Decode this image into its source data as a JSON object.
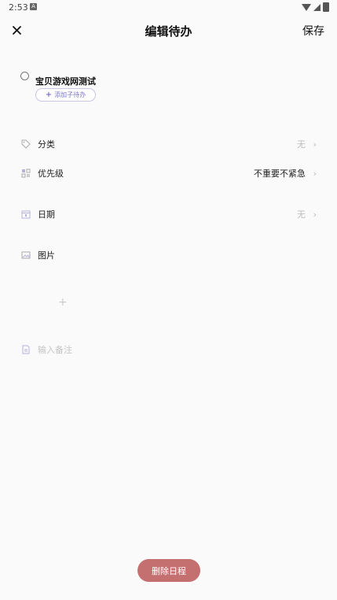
{
  "status_bar": {
    "time": "2:53",
    "left_icon": "A"
  },
  "header": {
    "title": "编辑待办",
    "save_label": "保存"
  },
  "task": {
    "title": "宝贝游戏网测试",
    "add_subtask_label": "添加子待办"
  },
  "fields": {
    "category": {
      "label": "分类",
      "value": "无"
    },
    "priority": {
      "label": "优先级",
      "value": "不重要不紧急"
    },
    "date": {
      "label": "日期",
      "value": "无"
    },
    "image": {
      "label": "图片"
    }
  },
  "note": {
    "placeholder": "输入备注"
  },
  "delete_label": "删除日程",
  "icons": {
    "close": "close-icon",
    "tag": "tag-icon",
    "priority": "grid-icon",
    "date": "calendar-icon",
    "image": "image-icon",
    "note": "document-icon",
    "add": "plus-icon"
  },
  "colors": {
    "accent": "#7a74c9",
    "delete": "#c57070",
    "muted": "#bbbbbb"
  }
}
